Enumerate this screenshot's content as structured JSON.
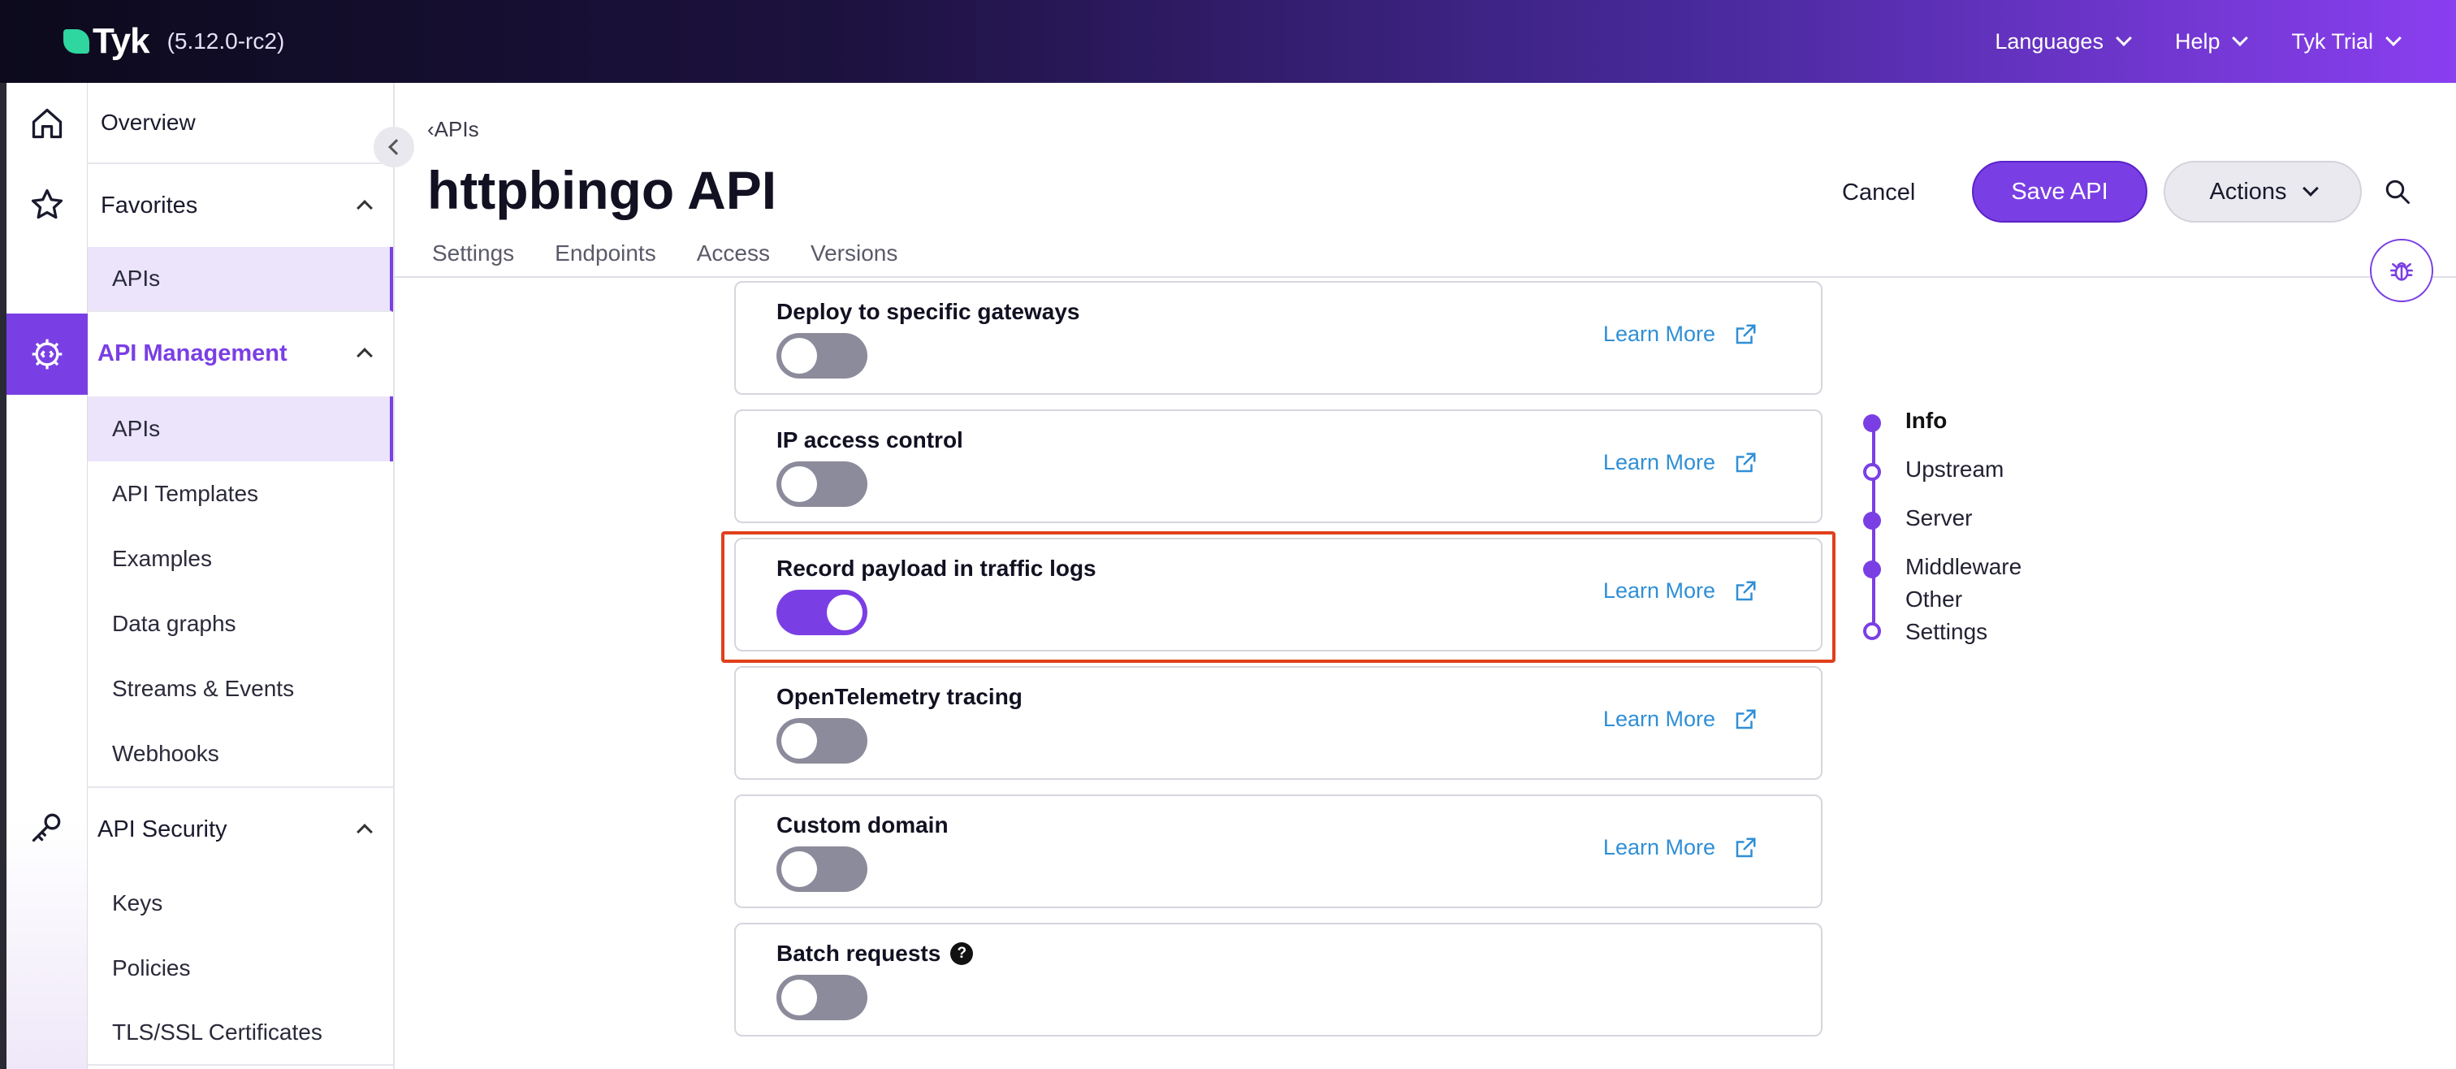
{
  "app": {
    "logo_text": "Tyk",
    "version": "(5.12.0-rc2)"
  },
  "topnav": [
    {
      "label": "Languages"
    },
    {
      "label": "Help"
    },
    {
      "label": "Tyk Trial"
    }
  ],
  "sidebar": {
    "overview": "Overview",
    "favorites": {
      "label": "Favorites",
      "items": [
        "APIs"
      ]
    },
    "api_management": {
      "label": "API Management",
      "items": [
        "APIs",
        "API Templates",
        "Examples",
        "Data graphs",
        "Streams & Events",
        "Webhooks"
      ]
    },
    "api_security": {
      "label": "API Security",
      "items": [
        "Keys",
        "Policies",
        "TLS/SSL Certificates"
      ]
    }
  },
  "header": {
    "breadcrumb": "‹APIs",
    "title": "httpbingo API",
    "tabs": [
      "Settings",
      "Endpoints",
      "Access",
      "Versions"
    ],
    "cancel": "Cancel",
    "save": "Save API",
    "actions": "Actions"
  },
  "cards": [
    {
      "title": "Deploy to specific gateways",
      "enabled": false,
      "link": "Learn More"
    },
    {
      "title": "IP access control",
      "enabled": false,
      "link": "Learn More"
    },
    {
      "title": "Record payload in traffic logs",
      "enabled": true,
      "link": "Learn More"
    },
    {
      "title": "OpenTelemetry tracing",
      "enabled": false,
      "link": "Learn More"
    },
    {
      "title": "Custom domain",
      "enabled": false,
      "link": "Learn More"
    },
    {
      "title": "Batch requests",
      "enabled": false,
      "help": "?"
    }
  ],
  "stepper": [
    {
      "label": "Info",
      "filled": true
    },
    {
      "label": "Upstream",
      "filled": false
    },
    {
      "label": "Server",
      "filled": true
    },
    {
      "label": "Middleware",
      "filled": true
    },
    {
      "label": "Other Settings",
      "filled": false
    }
  ],
  "colors": {
    "accent": "#7a3fe4",
    "link": "#2f8fd6",
    "highlight": "#e0401c",
    "toggle_off": "#8b8b9b"
  }
}
